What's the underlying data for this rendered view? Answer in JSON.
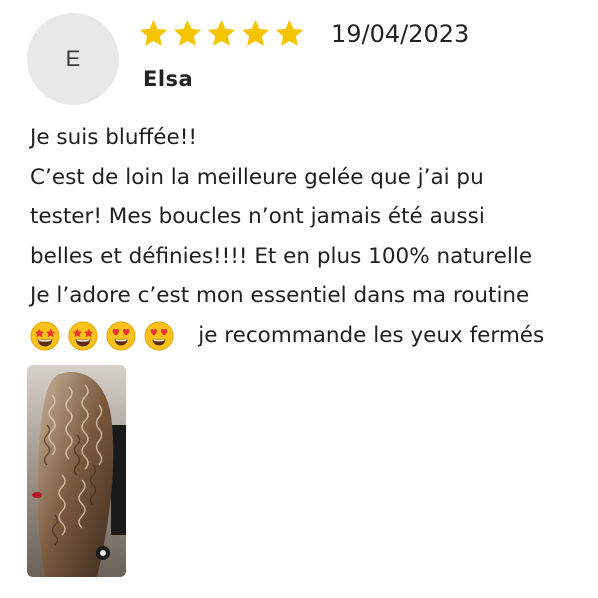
{
  "avatar": {
    "initial": "E"
  },
  "review": {
    "rating": 5,
    "rating_max": 5,
    "date": "19/04/2023",
    "author": "Elsa",
    "title": "Je suis bluffée!!",
    "lines": [
      "C’est de loin la meilleure gelée que j’ai pu",
      "tester! Mes boucles n’ont jamais été aussi",
      "belles et définies!!!! Et en plus 100% naturelle",
      "Je l’adore c’est mon essentiel dans ma routine"
    ],
    "emojis": [
      "star-struck",
      "star-struck",
      "heart-eyes",
      "heart-eyes"
    ],
    "last_line": "je recommande les yeux fermés"
  },
  "colors": {
    "star": "#f5c400",
    "avatar_bg": "#e8e8e8",
    "text": "#1f1f1f"
  },
  "photo": {
    "icon": "curly-hair-photo"
  }
}
